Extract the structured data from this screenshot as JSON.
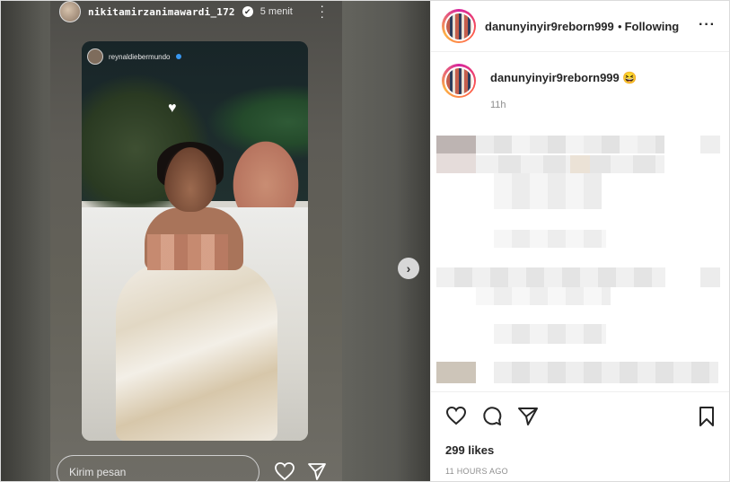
{
  "story": {
    "username": "nikitamirzanimawardi_172",
    "verified_glyph": "✔",
    "time": "5 menit",
    "more_icon": "more-vertical-icon",
    "inner_username": "reynaldiebermundo",
    "reply_placeholder": "Kirim pesan",
    "heart_icon": "heart-icon",
    "send_icon": "send-icon"
  },
  "nav": {
    "next_glyph": "›"
  },
  "post": {
    "header_username": "danunyinyir9reborn999",
    "header_dot": "•",
    "header_follow": "Following",
    "header_more": "···",
    "caption_username": "danunyinyir9reborn999",
    "caption_emoji": "😆",
    "caption_time": "11h",
    "likes": "299 likes",
    "ago": "11 HOURS AGO"
  },
  "colors": {
    "text": "#262626",
    "muted": "#8e8e8e",
    "border": "#efefef"
  }
}
